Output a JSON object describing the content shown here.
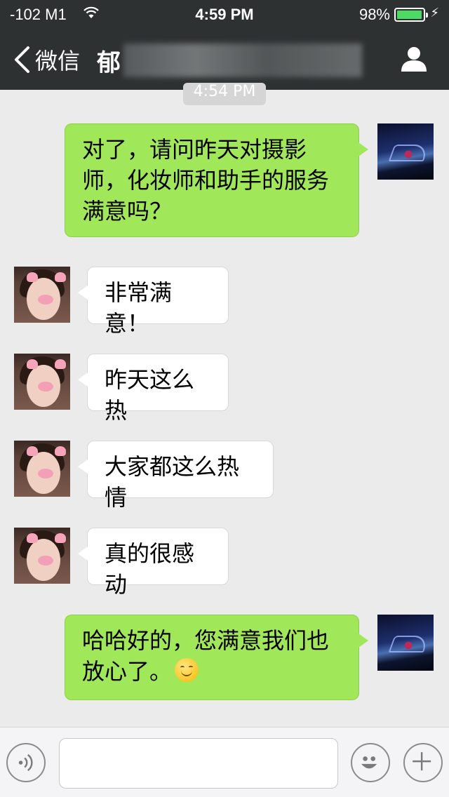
{
  "status_bar": {
    "carrier": "-102 M1",
    "time": "4:59 PM",
    "battery_pct": "98%",
    "battery_level": 0.98
  },
  "nav": {
    "back_label": "微信",
    "title": "郁"
  },
  "timestamp": "4:54 PM",
  "messages": [
    {
      "from": "me",
      "text": "对了，请问昨天对摄影师，化妆师和助手的服务满意吗？"
    },
    {
      "from": "contact",
      "text": "非常满意！"
    },
    {
      "from": "contact",
      "text": "昨天这么热"
    },
    {
      "from": "contact",
      "text": "大家都这么热情"
    },
    {
      "from": "contact",
      "text": "真的很感动"
    },
    {
      "from": "me",
      "text": "哈哈好的，您满意我们也放心了。",
      "emoji": "smiling-face-emoji"
    }
  ],
  "input": {
    "value": "",
    "placeholder": ""
  },
  "icons": {
    "back": "chevron-left-icon",
    "profile": "person-icon",
    "voice": "voice-icon",
    "emoji": "emoji-icon",
    "plus": "plus-icon",
    "wifi": "wifi-icon",
    "battery": "battery-icon",
    "charging": "charging-icon"
  },
  "colors": {
    "header_bg": "#2e3132",
    "chat_bg": "#ebebeb",
    "outgoing_bubble": "#a0e75a",
    "incoming_bubble": "#ffffff",
    "battery_fill": "#4cd964"
  }
}
